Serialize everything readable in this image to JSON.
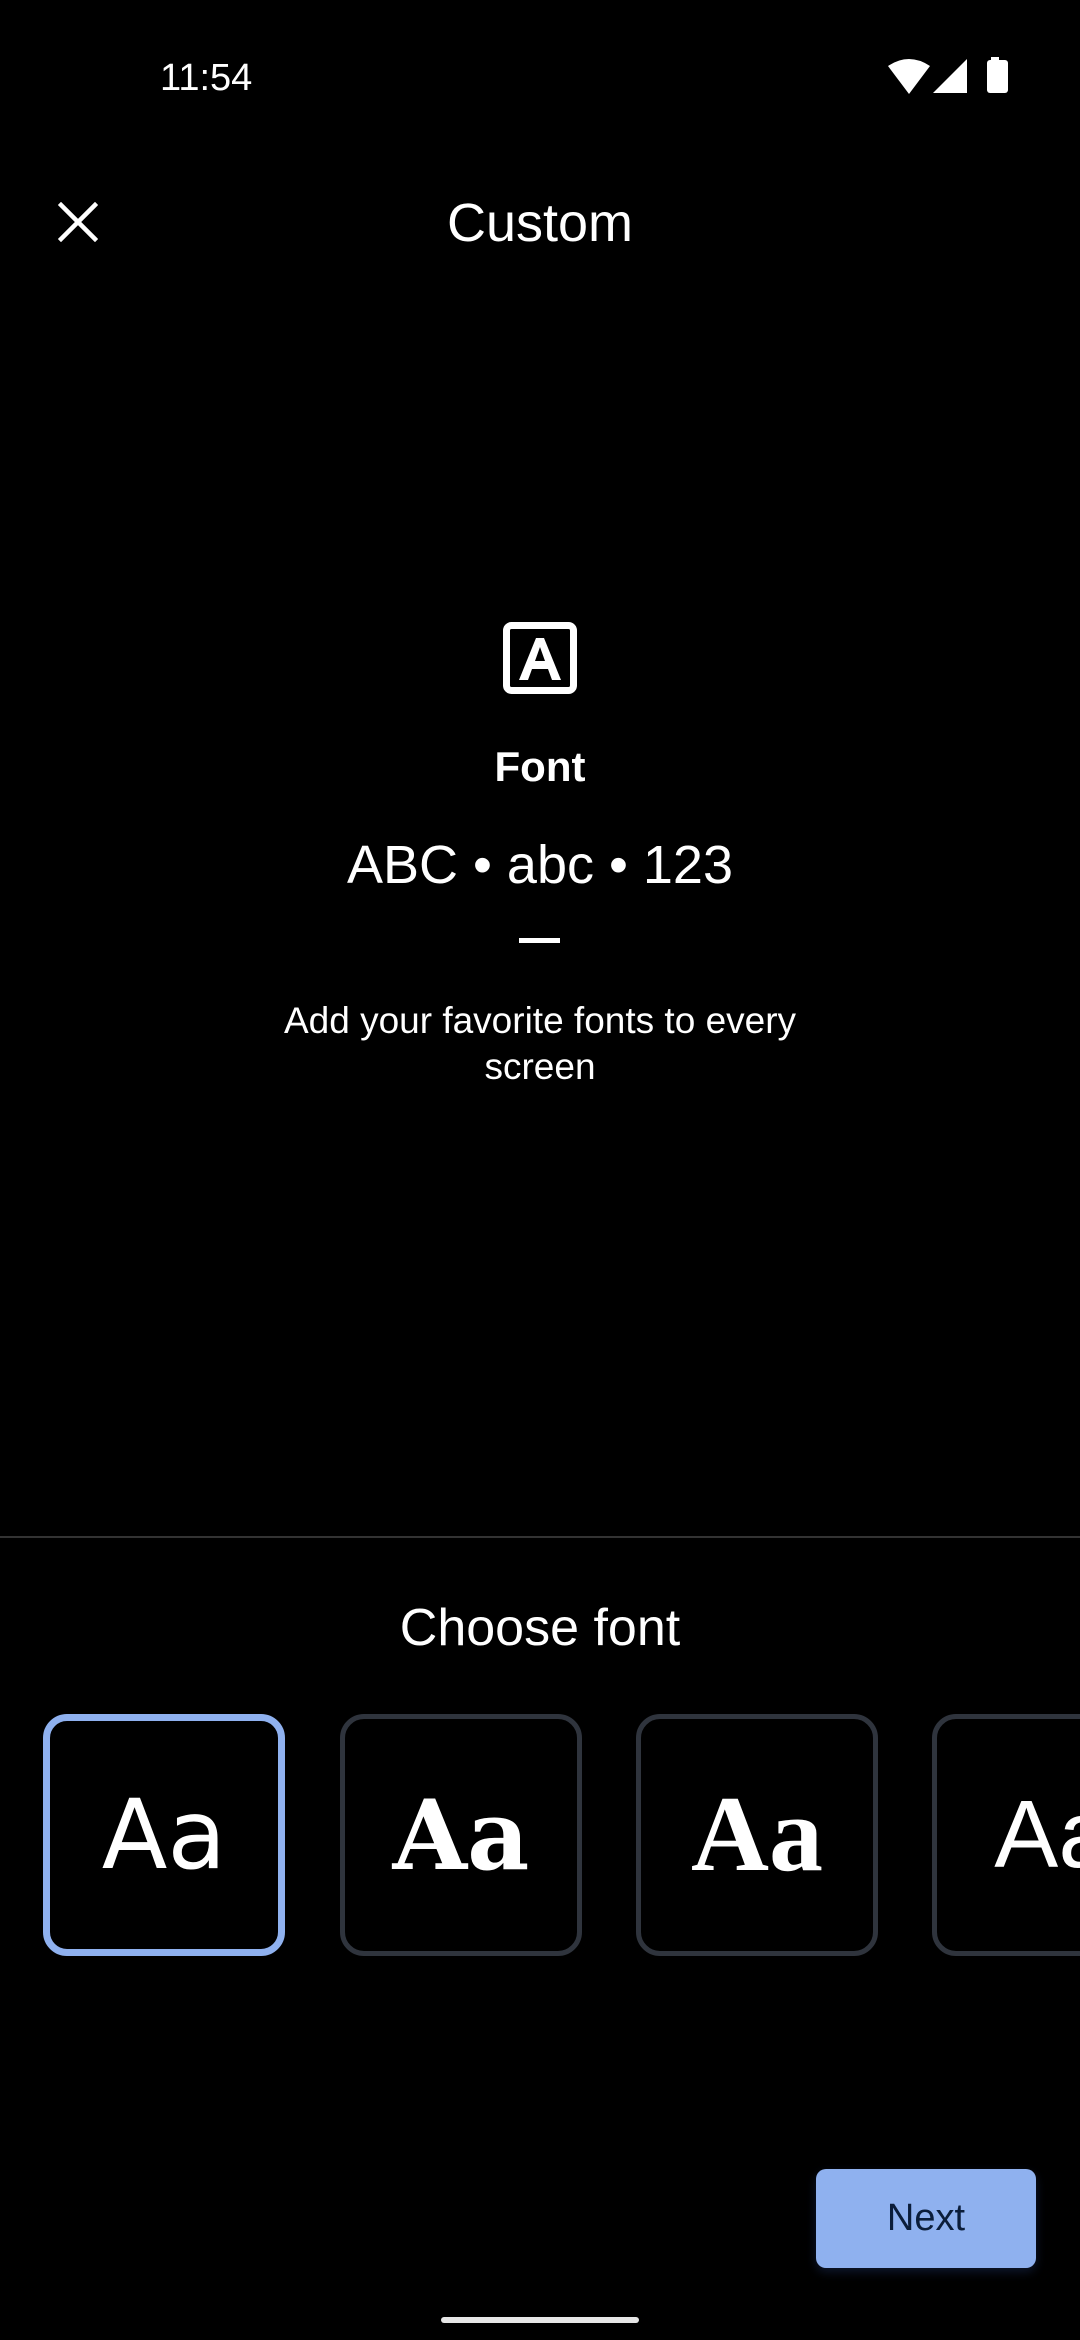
{
  "status_bar": {
    "time": "11:54",
    "icons": [
      "wifi-icon",
      "signal-icon",
      "battery-icon"
    ]
  },
  "header": {
    "close_icon": "close-icon",
    "title": "Custom"
  },
  "preview": {
    "icon": "font-icon",
    "icon_glyph": "A",
    "label": "Font",
    "sample_text": "ABC • abc • 123",
    "description": "Add your favorite fonts to every screen"
  },
  "picker": {
    "title": "Choose font",
    "options": [
      {
        "label": "Aa",
        "selected": true
      },
      {
        "label": "Aa",
        "selected": false
      },
      {
        "label": "Aa",
        "selected": false
      },
      {
        "label": "Aa",
        "selected": false
      }
    ]
  },
  "footer": {
    "next_label": "Next"
  },
  "colors": {
    "background": "#000000",
    "accent": "#8fb1ef",
    "button_text": "#0b1d3a",
    "option_border": "#2f343d"
  }
}
